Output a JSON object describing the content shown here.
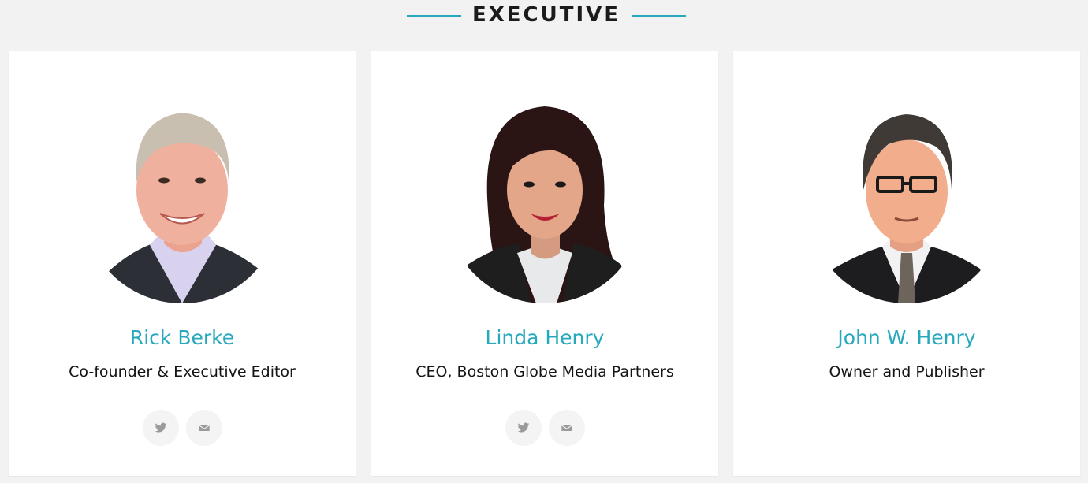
{
  "section": {
    "title": "EXECUTIVE",
    "accent_color": "#27a9bd"
  },
  "people": [
    {
      "name": "Rick Berke",
      "role": "Co-founder & Executive Editor",
      "portrait_icon": "portrait-illustration",
      "social": [
        "twitter-icon",
        "email-icon"
      ]
    },
    {
      "name": "Linda Henry",
      "role": "CEO, Boston Globe Media Partners",
      "portrait_icon": "portrait-illustration",
      "social": [
        "twitter-icon",
        "email-icon"
      ]
    },
    {
      "name": "John W. Henry",
      "role": "Owner and Publisher",
      "portrait_icon": "portrait-illustration",
      "social": []
    }
  ]
}
